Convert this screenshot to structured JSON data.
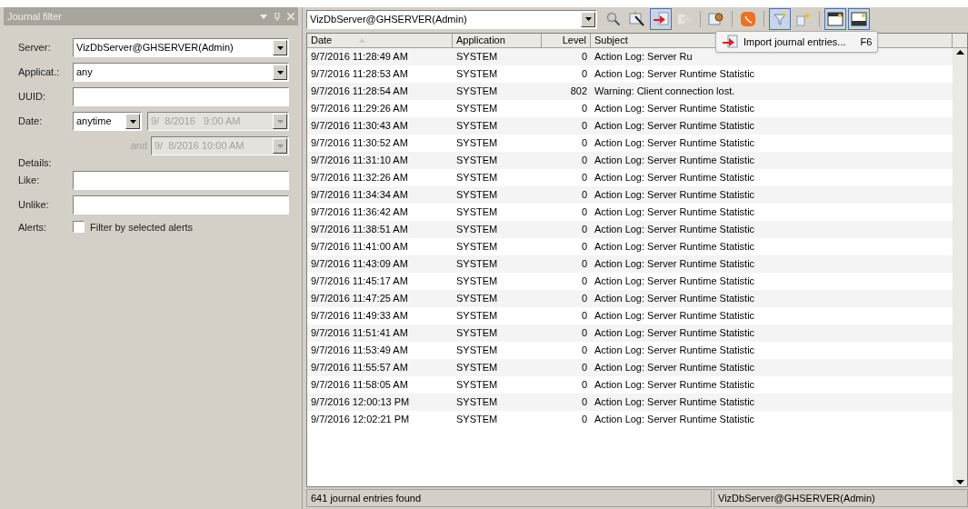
{
  "filter_panel": {
    "title": "Journal filter",
    "server": {
      "label": "Server:",
      "value": "VizDbServer@GHSERVER(Admin)"
    },
    "application": {
      "label": "Applicat.:",
      "value": "any"
    },
    "uuid": {
      "label": "UUID:"
    },
    "date": {
      "label": "Date:",
      "value": "anytime",
      "from": "9/  8/2016   9:00 AM",
      "and_label": "and",
      "to": "9/  8/2016 10:00 AM",
      "disabled": true
    },
    "details": {
      "label": "Details:"
    },
    "like": {
      "label": "Like:"
    },
    "unlike": {
      "label": "Unlike:"
    },
    "alerts": {
      "label": "Alerts:",
      "checkbox_label": "Filter by selected alerts",
      "checked": false
    }
  },
  "toolbar": {
    "server": "VizDbServer@GHSERVER(Admin)",
    "buttons": [
      {
        "kind": "search",
        "pressed": false,
        "disabled": false
      },
      {
        "kind": "wand",
        "pressed": false,
        "disabled": false
      },
      {
        "kind": "import",
        "pressed": true,
        "disabled": false
      },
      {
        "kind": "forward",
        "pressed": false,
        "disabled": true
      },
      {
        "kind": "sep"
      },
      {
        "kind": "note",
        "pressed": false,
        "disabled": false
      },
      {
        "kind": "sep"
      },
      {
        "kind": "badge",
        "pressed": false,
        "disabled": false
      },
      {
        "kind": "sep"
      },
      {
        "kind": "filter",
        "pressed": true,
        "disabled": false
      },
      {
        "kind": "info",
        "pressed": false,
        "disabled": false
      },
      {
        "kind": "sep"
      },
      {
        "kind": "layout_top",
        "pressed": true,
        "disabled": false
      },
      {
        "kind": "layout_bottom",
        "pressed": true,
        "disabled": false
      }
    ]
  },
  "tooltip": {
    "text": "Import journal entries...",
    "shortcut": "F6"
  },
  "table": {
    "columns": [
      "Date",
      "Application",
      "Level",
      "Subject"
    ],
    "rows": [
      [
        "9/7/2016 11:28:49 AM",
        "SYSTEM",
        "0",
        "Action Log: Server Ru"
      ],
      [
        "9/7/2016 11:28:53 AM",
        "SYSTEM",
        "0",
        "Action Log: Server Runtime Statistic"
      ],
      [
        "9/7/2016 11:28:54 AM",
        "SYSTEM",
        "802",
        "Warning: Client connection lost."
      ],
      [
        "9/7/2016 11:29:26 AM",
        "SYSTEM",
        "0",
        "Action Log: Server Runtime Statistic"
      ],
      [
        "9/7/2016 11:30:43 AM",
        "SYSTEM",
        "0",
        "Action Log: Server Runtime Statistic"
      ],
      [
        "9/7/2016 11:30:52 AM",
        "SYSTEM",
        "0",
        "Action Log: Server Runtime Statistic"
      ],
      [
        "9/7/2016 11:31:10 AM",
        "SYSTEM",
        "0",
        "Action Log: Server Runtime Statistic"
      ],
      [
        "9/7/2016 11:32:26 AM",
        "SYSTEM",
        "0",
        "Action Log: Server Runtime Statistic"
      ],
      [
        "9/7/2016 11:34:34 AM",
        "SYSTEM",
        "0",
        "Action Log: Server Runtime Statistic"
      ],
      [
        "9/7/2016 11:36:42 AM",
        "SYSTEM",
        "0",
        "Action Log: Server Runtime Statistic"
      ],
      [
        "9/7/2016 11:38:51 AM",
        "SYSTEM",
        "0",
        "Action Log: Server Runtime Statistic"
      ],
      [
        "9/7/2016 11:41:00 AM",
        "SYSTEM",
        "0",
        "Action Log: Server Runtime Statistic"
      ],
      [
        "9/7/2016 11:43:09 AM",
        "SYSTEM",
        "0",
        "Action Log: Server Runtime Statistic"
      ],
      [
        "9/7/2016 11:45:17 AM",
        "SYSTEM",
        "0",
        "Action Log: Server Runtime Statistic"
      ],
      [
        "9/7/2016 11:47:25 AM",
        "SYSTEM",
        "0",
        "Action Log: Server Runtime Statistic"
      ],
      [
        "9/7/2016 11:49:33 AM",
        "SYSTEM",
        "0",
        "Action Log: Server Runtime Statistic"
      ],
      [
        "9/7/2016 11:51:41 AM",
        "SYSTEM",
        "0",
        "Action Log: Server Runtime Statistic"
      ],
      [
        "9/7/2016 11:53:49 AM",
        "SYSTEM",
        "0",
        "Action Log: Server Runtime Statistic"
      ],
      [
        "9/7/2016 11:55:57 AM",
        "SYSTEM",
        "0",
        "Action Log: Server Runtime Statistic"
      ],
      [
        "9/7/2016 11:58:05 AM",
        "SYSTEM",
        "0",
        "Action Log: Server Runtime Statistic"
      ],
      [
        "9/7/2016 12:00:13 PM",
        "SYSTEM",
        "0",
        "Action Log: Server Runtime Statistic"
      ],
      [
        "9/7/2016 12:02:21 PM",
        "SYSTEM",
        "0",
        "Action Log: Server Runtime Statistic"
      ]
    ]
  },
  "status_bar": {
    "count": "641 journal entries found",
    "server": "VizDbServer@GHSERVER(Admin)"
  }
}
